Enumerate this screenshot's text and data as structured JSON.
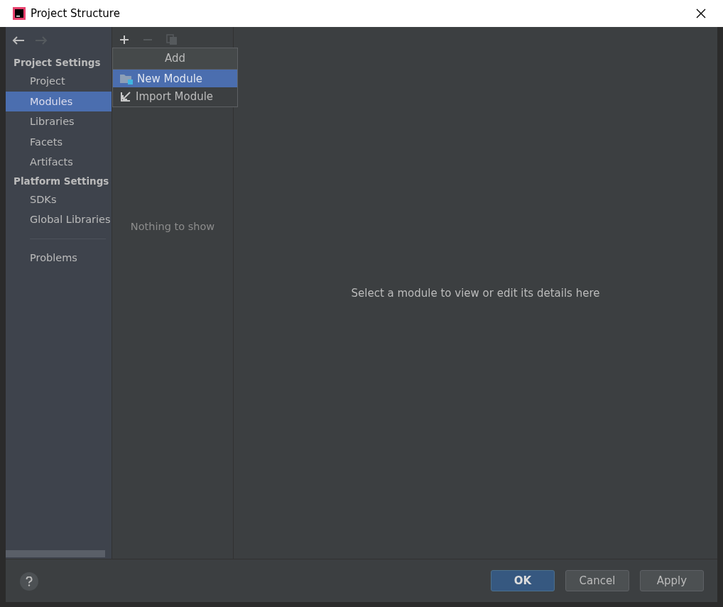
{
  "window": {
    "title": "Project Structure"
  },
  "sidebar": {
    "sections": [
      {
        "title": "Project Settings",
        "items": [
          {
            "label": "Project",
            "selected": false
          },
          {
            "label": "Modules",
            "selected": true
          },
          {
            "label": "Libraries",
            "selected": false
          },
          {
            "label": "Facets",
            "selected": false
          },
          {
            "label": "Artifacts",
            "selected": false
          }
        ]
      },
      {
        "title": "Platform Settings",
        "items": [
          {
            "label": "SDKs",
            "selected": false
          },
          {
            "label": "Global Libraries",
            "selected": false
          }
        ]
      }
    ],
    "bottom_items": [
      {
        "label": "Problems",
        "selected": false
      }
    ]
  },
  "module_list": {
    "empty_text": "Nothing to show"
  },
  "add_menu": {
    "title": "Add",
    "items": [
      {
        "label": "New Module",
        "kind": "new",
        "selected": true
      },
      {
        "label": "Import Module",
        "kind": "import",
        "selected": false
      }
    ]
  },
  "details": {
    "empty_text": "Select a module to view or edit its details here"
  },
  "buttons": [
    {
      "label": "OK",
      "kind": "default"
    },
    {
      "label": "Cancel",
      "kind": "normal"
    },
    {
      "label": "Apply",
      "kind": "normal"
    }
  ]
}
